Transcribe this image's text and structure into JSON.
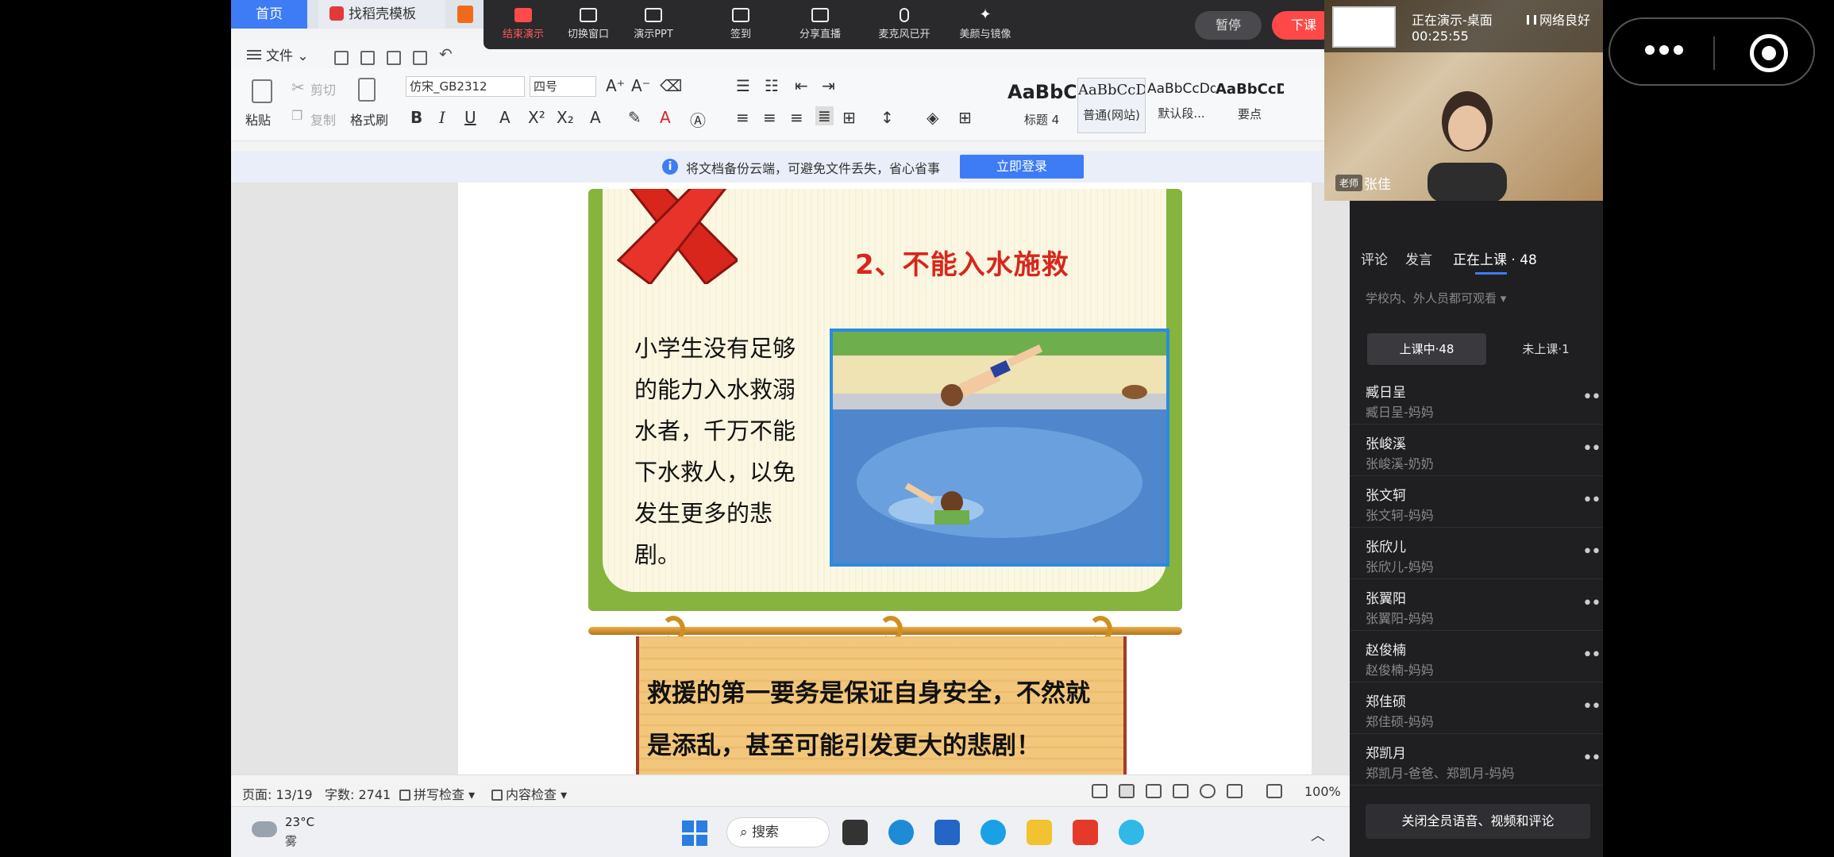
{
  "wps": {
    "tabs": {
      "home": "首页",
      "template": "找稻壳模板"
    },
    "file_menu": "文件",
    "ribbon": {
      "paste": "粘贴",
      "cut": "剪切",
      "copy": "复制",
      "format_painter": "格式刷",
      "font_name": "仿宋_GB2312",
      "font_size": "四号",
      "styles": [
        {
          "sample": "AaBbC",
          "name": "标题 4"
        },
        {
          "sample": "AaBbCcDc",
          "name": "普通(网站)"
        },
        {
          "sample": "AaBbCcDd",
          "name": "默认段..."
        },
        {
          "sample": "AaBbCcDc",
          "name": "要点"
        }
      ]
    },
    "cloud_bar": {
      "text": "将文档备份云端，可避免文件丢失，省心省事",
      "login": "立即登录"
    },
    "status_bar": {
      "page": "页面: 13/19",
      "words": "字数: 2741",
      "spell": "拼写检查",
      "content": "内容检查",
      "zoom": "100%"
    }
  },
  "live_toolbar": {
    "buttons": [
      "结束演示",
      "切换窗口",
      "演示PPT",
      "签到",
      "分享直播",
      "麦克风已开",
      "美颜与镜像"
    ],
    "pause": "暂停",
    "end_class": "下课"
  },
  "slide": {
    "title": "2、不能入水施救",
    "body": "小学生没有足够的能力入水救溺水者，千万不能下水救人，以免发生更多的悲剧。",
    "banner_line1": "救援的第一要务是保证自身安全，不然就",
    "banner_line2": "是添乱，甚至可能引发更大的悲剧！"
  },
  "taskbar": {
    "weather_temp": "23°C",
    "weather_desc": "雾",
    "search": "搜索"
  },
  "teacher": {
    "live_status": "正在演示-桌面",
    "timer": "00:25:55",
    "network": "网络良好",
    "tag": "老师",
    "name": "张佳"
  },
  "panel": {
    "tabs": [
      "评论",
      "发言",
      "正在上课 · 48"
    ],
    "visibility": "学校内、外人员都可观看",
    "seg_in": "上课中·48",
    "seg_out": "未上课·1",
    "students": [
      {
        "name": "臧日呈",
        "parent": "臧日呈-妈妈"
      },
      {
        "name": "张峻溪",
        "parent": "张峻溪-奶奶"
      },
      {
        "name": "张文轲",
        "parent": "张文轲-妈妈"
      },
      {
        "name": "张欣儿",
        "parent": "张欣儿-妈妈"
      },
      {
        "name": "张翼阳",
        "parent": "张翼阳-妈妈"
      },
      {
        "name": "赵俊楠",
        "parent": "赵俊楠-妈妈"
      },
      {
        "name": "郑佳硕",
        "parent": "郑佳硕-妈妈"
      },
      {
        "name": "郑凯月",
        "parent": "郑凯月-爸爸、郑凯月-妈妈"
      }
    ],
    "mute_all": "关闭全员语音、视频和评论"
  },
  "colors": {
    "accent": "#3d7cf5",
    "end_class": "#ff4949",
    "slide_title": "#d8261c"
  }
}
